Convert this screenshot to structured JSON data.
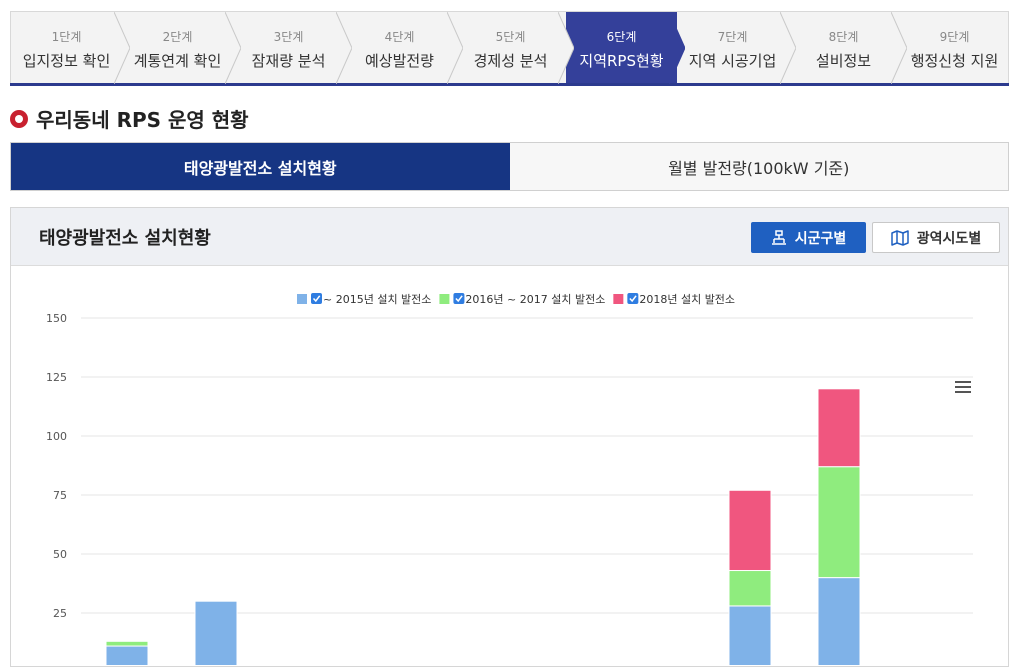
{
  "steps": [
    {
      "num": "1단계",
      "label": "입지정보 확인"
    },
    {
      "num": "2단계",
      "label": "계통연계 확인"
    },
    {
      "num": "3단계",
      "label": "잠재량 분석"
    },
    {
      "num": "4단계",
      "label": "예상발전량"
    },
    {
      "num": "5단계",
      "label": "경제성 분석"
    },
    {
      "num": "6단계",
      "label": "지역RPS현황"
    },
    {
      "num": "7단계",
      "label": "지역 시공기업"
    },
    {
      "num": "8단계",
      "label": "설비정보"
    },
    {
      "num": "9단계",
      "label": "행정신청 지원"
    }
  ],
  "active_step": 5,
  "section_title": "우리동네 RPS 운영 현황",
  "tabs": {
    "active": "태양광발전소 설치현황",
    "inactive": "월별 발전량(100kW 기준)"
  },
  "panel": {
    "title": "태양광발전소 설치현황",
    "btn_primary": "시군구별",
    "btn_secondary": "광역시도별"
  },
  "colors": {
    "nav": "#34409a",
    "tab": "#163583",
    "btn": "#1f60c1",
    "s1": "#7fb2e8",
    "s2": "#8fec7e",
    "s3": "#f0567f"
  },
  "chart_data": {
    "type": "bar",
    "stacked": true,
    "title": "",
    "xlabel": "",
    "ylabel": "",
    "ylim": [
      0,
      150
    ],
    "yticks": [
      25,
      50,
      75,
      100,
      125,
      150
    ],
    "categories": [
      "",
      "",
      "",
      "",
      "",
      "",
      "",
      "",
      "",
      ""
    ],
    "series": [
      {
        "name": "~ 2015년 설치 발전소",
        "color": "#7fb2e8",
        "values": [
          11,
          30,
          0,
          1,
          0,
          1,
          0,
          28,
          40,
          2
        ]
      },
      {
        "name": "2016년 ~ 2017 설치 발전소",
        "color": "#8fec7e",
        "values": [
          2,
          0,
          0,
          0,
          0,
          0,
          0,
          15,
          47,
          0
        ]
      },
      {
        "name": "2018년 설치 발전소",
        "color": "#f0567f",
        "values": [
          0,
          0,
          0,
          0,
          0,
          0,
          0,
          34,
          33,
          0
        ]
      }
    ],
    "legend_position": "top-center",
    "grid": true,
    "menu_icon": "hamburger-icon"
  }
}
